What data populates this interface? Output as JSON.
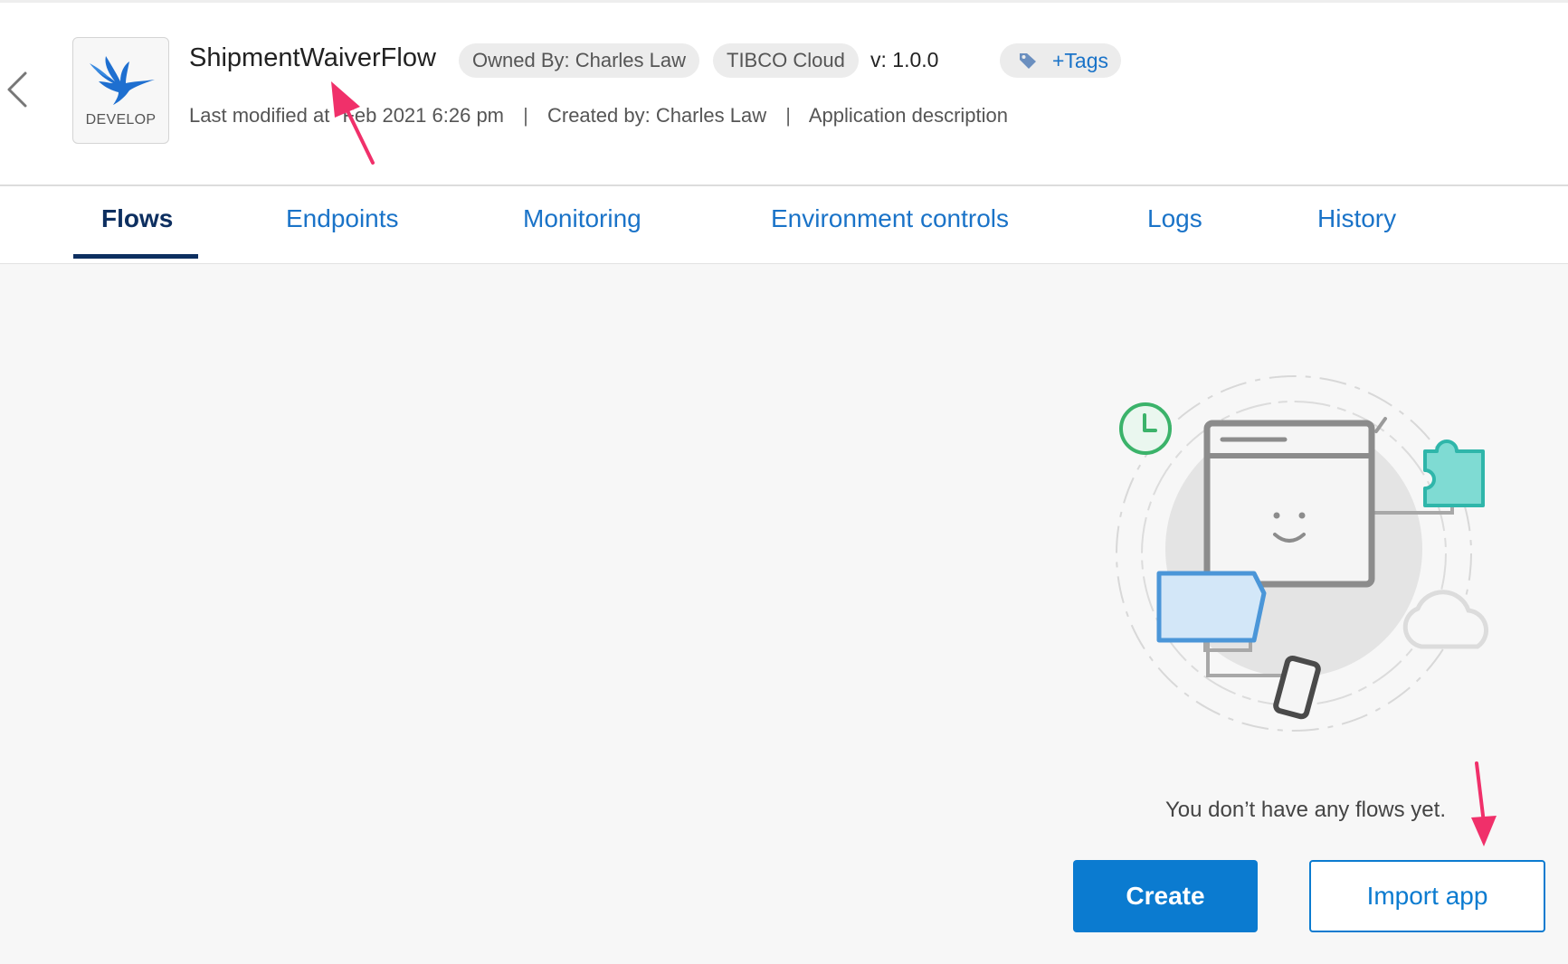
{
  "app": {
    "name": "ShipmentWaiverFlow",
    "stage": "DEVELOP",
    "owner": "Owned By: Charles Law",
    "platform": "TIBCO Cloud",
    "version": "v: 1.0.0",
    "tags_label": "+Tags",
    "last_modified": "Last modified at",
    "modified_date": "Feb 2021 6:26 pm",
    "created_by": "Created by: Charles Law",
    "description": "Application description",
    "separator": "|"
  },
  "tabs": [
    {
      "label": "Flows",
      "active": true
    },
    {
      "label": "Endpoints",
      "active": false
    },
    {
      "label": "Monitoring",
      "active": false
    },
    {
      "label": "Environment controls",
      "active": false
    },
    {
      "label": "Logs",
      "active": false
    },
    {
      "label": "History",
      "active": false
    }
  ],
  "empty_state": {
    "message": "You don’t have any flows yet.",
    "create_label": "Create",
    "import_label": "Import app"
  },
  "icons": {
    "back": "chevron-left-icon",
    "logo": "hummingbird-logo-icon",
    "tag": "tag-icon",
    "annotation": "pink-arrow-annotation"
  },
  "colors": {
    "accent": "#0b7bd0",
    "link": "#1a73c8",
    "active_tab": "#0d2f60",
    "annotation": "#f0306a",
    "content_bg": "#f7f7f7"
  }
}
